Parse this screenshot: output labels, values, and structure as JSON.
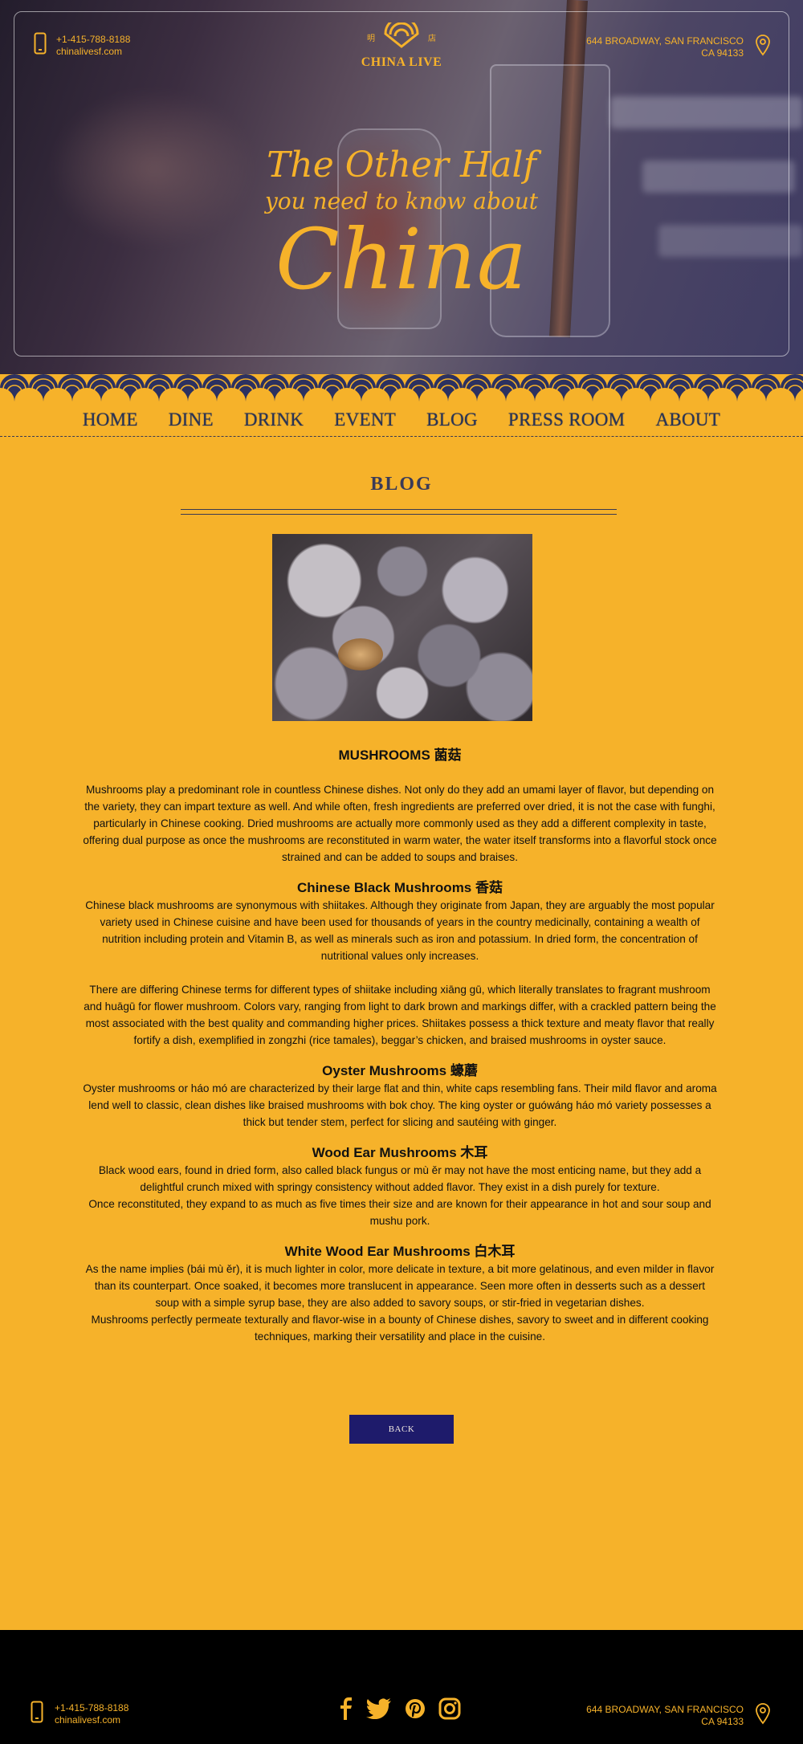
{
  "brand": {
    "name": "CHINA LIVE",
    "han_left": "明",
    "han_right": "店",
    "phone": "+1-415-788-8188",
    "website": "chinalivesf.com",
    "address_line1": "644 BROADWAY, SAN FRANCISCO",
    "address_line2": "CA 94133",
    "accent": "#f6b22a",
    "navy": "#2a3454"
  },
  "hero": {
    "line1": "The Other Half",
    "line2": "you need to know about",
    "line3": "China"
  },
  "nav": {
    "items": [
      {
        "label": "HOME"
      },
      {
        "label": "DINE"
      },
      {
        "label": "DRINK"
      },
      {
        "label": "EVENT"
      },
      {
        "label": "BLOG"
      },
      {
        "label": "PRESS ROOM"
      },
      {
        "label": "ABOUT"
      }
    ]
  },
  "page": {
    "section_title": "BLOG",
    "back_label": "BACK"
  },
  "article": {
    "title": "MUSHROOMS 菌菇",
    "intro": "Mushrooms play a predominant role in countless Chinese dishes. Not only do they add an umami layer of flavor, but depending on the variety, they can impart texture as well. And while often, fresh ingredients are preferred over dried, it is not the case with funghi, particularly in Chinese cooking. Dried mushrooms are actually more commonly used as they add a different complexity in taste, offering dual purpose as once the mushrooms are reconstituted in warm water, the water itself transforms into a flavorful stock once strained and can be added to soups and braises.",
    "sections": [
      {
        "heading": "Chinese Black Mushrooms 香菇",
        "p1": "Chinese black mushrooms are synonymous with shiitakes. Although they originate from Japan, they are arguably the most popular variety used in Chinese cuisine and have been used for thousands of years in the country medicinally, containing a wealth of nutrition including protein and Vitamin B, as well as minerals such as iron and potassium. In dried form, the concentration of nutritional values only increases.",
        "p2": "There are differing Chinese terms for different types of shiitake including xiāng gū, which literally translates to fragrant mushroom and huāgū for flower mushroom. Colors vary, ranging from light to dark brown and markings differ, with a crackled pattern being the most associated with the best quality and commanding higher prices. Shiitakes possess a thick texture and meaty flavor that really fortify a dish, exemplified in zongzhi (rice tamales), beggar’s chicken, and braised mushrooms in oyster sauce."
      },
      {
        "heading": "Oyster Mushrooms 蠔蘑",
        "p1": "Oyster mushrooms or háo mó are characterized by their large flat and thin, white caps resembling fans. Their mild flavor and aroma lend well to classic, clean dishes like braised mushrooms with bok choy. The king oyster or guówáng háo mó variety possesses a thick but tender stem, perfect for slicing and sautéing with ginger."
      },
      {
        "heading": "Wood Ear Mushrooms 木耳",
        "p1": "Black wood ears, found in dried form, also called black fungus or mù ěr may not have the most enticing name, but they add a delightful crunch mixed with springy consistency without added flavor. They exist in a dish purely for texture.",
        "p2": "Once reconstituted, they expand to as much as five times their size and are known for their appearance in hot and sour soup and mushu pork."
      },
      {
        "heading": "White Wood Ear Mushrooms 白木耳",
        "p1": "As the name implies (bái mù ěr), it is much lighter in color, more delicate in texture, a bit more gelatinous, and even milder in flavor than its counterpart. Once soaked, it becomes more translucent in appearance. Seen more often in desserts such as a dessert soup with a simple syrup base, they are also added to savory soups, or stir-fried in vegetarian dishes.",
        "p2": "Mushrooms perfectly permeate texturally and flavor-wise in a bounty of Chinese dishes, savory to sweet and in different cooking techniques, marking their versatility and place in the cuisine."
      }
    ]
  },
  "footer": {
    "social": [
      "facebook-icon",
      "twitter-icon",
      "pinterest-icon",
      "instagram-icon"
    ]
  }
}
